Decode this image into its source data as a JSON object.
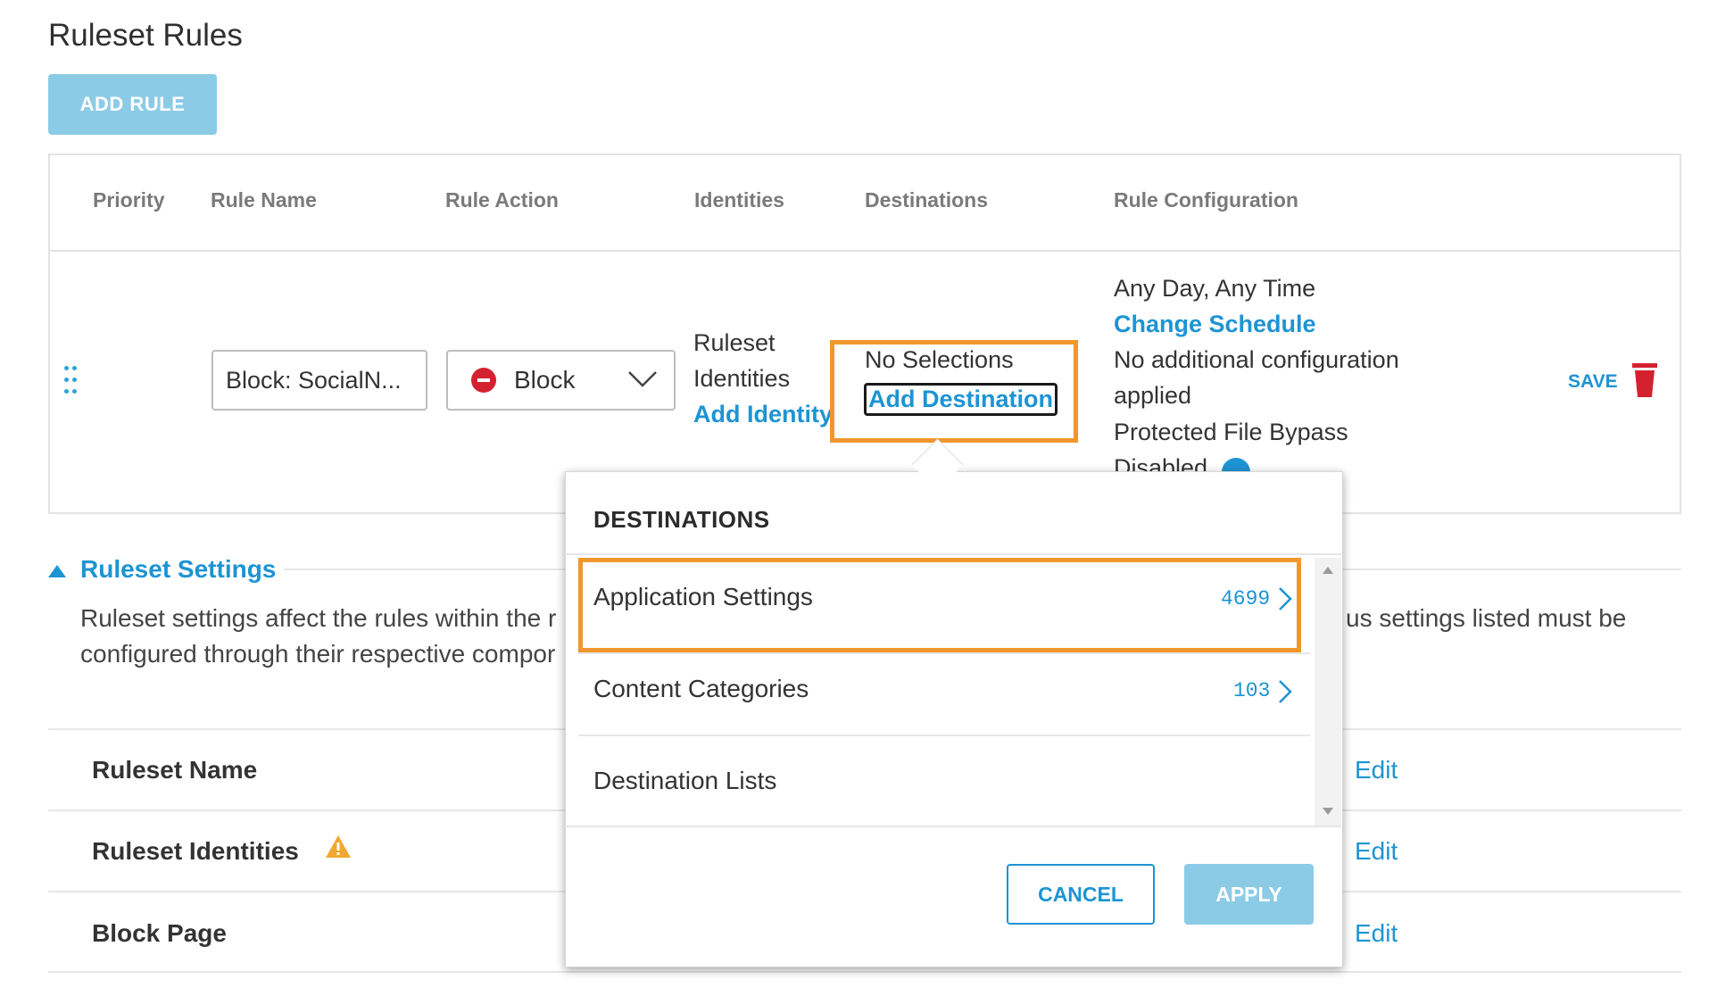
{
  "page": {
    "title": "Ruleset Rules",
    "add_rule_label": "ADD RULE"
  },
  "table": {
    "headers": [
      "Priority",
      "Rule Name",
      "Rule Action",
      "Identities",
      "Destinations",
      "Rule Configuration"
    ],
    "row": {
      "rule_name": "Block: SocialN...",
      "rule_action": "Block",
      "identities": {
        "line1": "Ruleset",
        "line2": "Identities",
        "link": "Add Identity"
      },
      "destinations": {
        "status": "No Selections",
        "link": "Add Destination"
      },
      "config": {
        "schedule": "Any Day, Any Time",
        "schedule_link": "Change Schedule",
        "additional_1": "No additional configuration",
        "additional_2": "applied",
        "bypass": "Protected File Bypass",
        "bypass_2": "Disabled"
      },
      "save_label": "SAVE"
    }
  },
  "settings": {
    "heading": "Ruleset Settings",
    "desc_line1_left": "Ruleset settings affect the rules within the r",
    "desc_line1_right": "us settings listed must be",
    "desc_line2_left": "configured through their respective compor",
    "rows": [
      {
        "label": "Ruleset Name",
        "edit": "Edit"
      },
      {
        "label": "Ruleset Identities",
        "edit": "Edit"
      },
      {
        "label": "Block Page",
        "edit": "Edit"
      }
    ]
  },
  "popover": {
    "title": "DESTINATIONS",
    "items": [
      {
        "label": "Application Settings",
        "count": "4699"
      },
      {
        "label": "Content Categories",
        "count": "103"
      },
      {
        "label": "Destination Lists",
        "count": ""
      }
    ],
    "cancel_label": "CANCEL",
    "apply_label": "APPLY"
  },
  "colors": {
    "accent": "#1d94d3",
    "highlight": "#f0962f",
    "block": "#d4212f",
    "disabled_btn": "#8ccbe6"
  }
}
